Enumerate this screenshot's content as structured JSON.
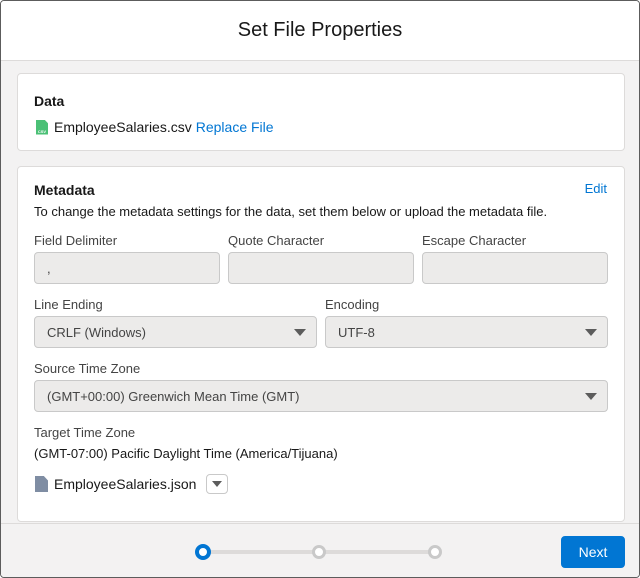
{
  "modal": {
    "title": "Set File Properties"
  },
  "data_card": {
    "title": "Data",
    "file_name": "EmployeeSalaries.csv",
    "file_icon": "csv-file-icon",
    "file_icon_text": "CSV",
    "replace_link": "Replace File"
  },
  "metadata_card": {
    "title": "Metadata",
    "edit_link": "Edit",
    "description": "To change the metadata settings for the data, set them below or upload the metadata file.",
    "field_delimiter": {
      "label": "Field Delimiter",
      "value": ","
    },
    "quote_character": {
      "label": "Quote Character",
      "value": ""
    },
    "escape_character": {
      "label": "Escape Character",
      "value": ""
    },
    "line_ending": {
      "label": "Line Ending",
      "value": "CRLF (Windows)"
    },
    "encoding": {
      "label": "Encoding",
      "value": "UTF-8"
    },
    "source_time_zone": {
      "label": "Source Time Zone",
      "value": "(GMT+00:00) Greenwich Mean Time (GMT)"
    },
    "target_time_zone": {
      "label": "Target Time Zone",
      "value": "(GMT-07:00) Pacific Daylight Time (America/Tijuana)"
    },
    "metadata_file": {
      "name": "EmployeeSalaries.json",
      "icon": "document-icon"
    }
  },
  "footer": {
    "progress_steps": 3,
    "current_step": 1,
    "next_label": "Next"
  },
  "colors": {
    "brand": "#0176d3",
    "csv_icon": "#4bc076",
    "body_bg": "#f3f2f2",
    "input_bg": "#ecebea"
  }
}
